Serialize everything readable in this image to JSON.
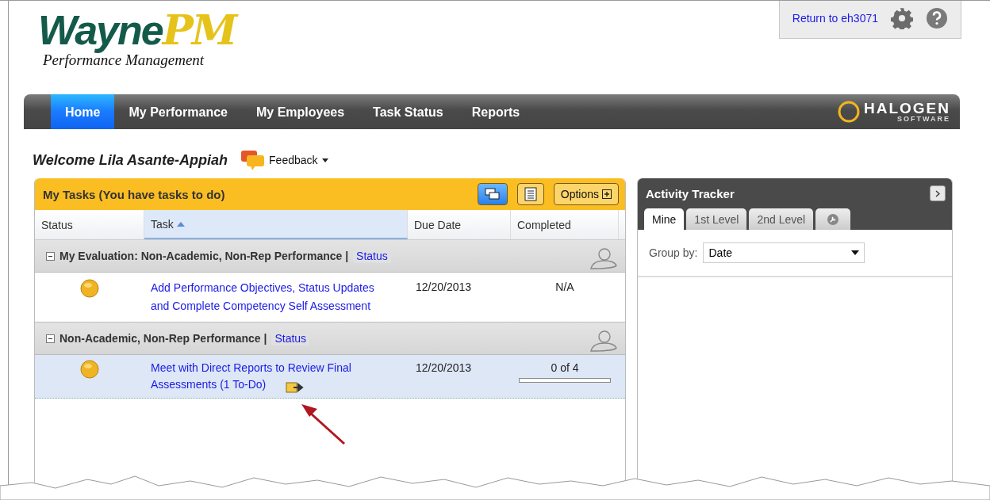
{
  "logo": {
    "main": "Wayne",
    "accent": "PM",
    "tagline": "Performance Management"
  },
  "utility": {
    "link": "Return to eh3071"
  },
  "nav": [
    {
      "label": "Home",
      "selected": true
    },
    {
      "label": "My Performance",
      "selected": false
    },
    {
      "label": "My Employees",
      "selected": false
    },
    {
      "label": "Task Status",
      "selected": false
    },
    {
      "label": "Reports",
      "selected": false
    }
  ],
  "vendor": {
    "name": "HALOGEN",
    "sub": "SOFTWARE"
  },
  "welcome": "Welcome Lila Asante-Appiah",
  "feedback": "Feedback",
  "tasks": {
    "title": "My Tasks (You have tasks to do)",
    "options": "Options",
    "views": [
      {
        "kind": "grouped",
        "selected": true
      },
      {
        "kind": "list",
        "selected": false
      }
    ],
    "columns": [
      {
        "label": "Status",
        "sorted": false
      },
      {
        "label": "Task",
        "sorted": true
      },
      {
        "label": "Due Date",
        "sorted": false
      },
      {
        "label": "Completed",
        "sorted": false
      }
    ],
    "groups": [
      {
        "title": "My Evaluation: Non-Academic, Non-Rep Performance |",
        "status_link": "Status",
        "expanded": true,
        "rows": [
          {
            "task": "Add Performance Objectives, Status Updates and Complete Competency Self Assessment",
            "due": "12/20/2013",
            "completed": "N/A",
            "selected": false,
            "launch": false
          }
        ]
      },
      {
        "title": "Non-Academic, Non-Rep Performance |",
        "status_link": "Status",
        "expanded": true,
        "rows": [
          {
            "task": "Meet with Direct Reports to Review Final Assessments (1 To-Do)",
            "due": "12/20/2013",
            "completed": "0 of 4",
            "level": 0,
            "selected": true,
            "launch": true
          }
        ]
      }
    ]
  },
  "tracker": {
    "title": "Activity Tracker",
    "tabs": [
      {
        "kind": "text",
        "label": "Mine",
        "selected": true
      },
      {
        "kind": "text",
        "label": "1st Level",
        "selected": false
      },
      {
        "kind": "text",
        "label": "2nd Level",
        "selected": false
      },
      {
        "kind": "icon",
        "selected": false
      }
    ],
    "group_by_label": "Group by:",
    "group_by_value": "Date"
  }
}
